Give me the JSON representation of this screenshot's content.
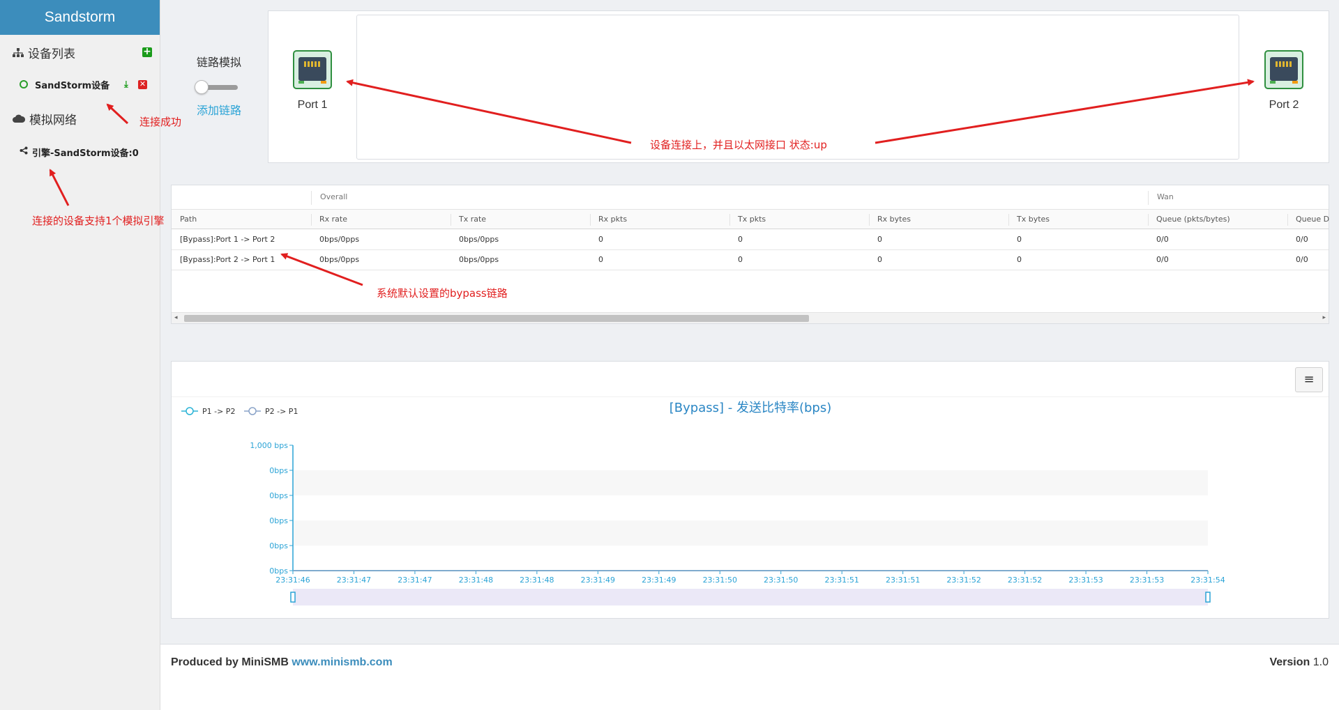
{
  "sidebar": {
    "brand": "Sandstorm",
    "devices_header": "设备列表",
    "device_name": "SandStorm设备",
    "network_header": "模拟网络",
    "engine_name": "引擎-SandStorm设备:0"
  },
  "link_sim": {
    "label": "链路模拟",
    "toggle_on": false,
    "add_link": "添加链路"
  },
  "topology": {
    "port1": "Port 1",
    "port2": "Port 2"
  },
  "annotations": {
    "connected": "连接成功",
    "engine_support": "连接的设备支持1个模拟引擎",
    "link_up": "设备连接上，并且以太网接口 状态:up",
    "bypass": "系统默认设置的bypass链路"
  },
  "stats": {
    "groups": [
      "Overall",
      "Wan"
    ],
    "headers": [
      "Path",
      "Rx rate",
      "Tx rate",
      "Rx pkts",
      "Tx pkts",
      "Rx bytes",
      "Tx bytes",
      "Queue (pkts/bytes)",
      "Queue D"
    ],
    "rows": [
      [
        "[Bypass]:Port 1 -> Port 2",
        "0bps/0pps",
        "0bps/0pps",
        "0",
        "0",
        "0",
        "0",
        "0/0",
        "0/0"
      ],
      [
        "[Bypass]:Port 2 -> Port 1",
        "0bps/0pps",
        "0bps/0pps",
        "0",
        "0",
        "0",
        "0",
        "0/0",
        "0/0"
      ]
    ]
  },
  "chart_data": {
    "type": "line",
    "title": "[Bypass] - 发送比特率(bps)",
    "menu_icon": "hamburger-menu-icon",
    "legend": [
      "P1 -> P2",
      "P2 -> P1"
    ],
    "y_tick_labels": [
      "1,000 bps",
      "0bps",
      "0bps",
      "0bps",
      "0bps",
      "0bps"
    ],
    "x_tick_labels": [
      "23:31:46",
      "23:31:47",
      "23:31:47",
      "23:31:48",
      "23:31:48",
      "23:31:49",
      "23:31:49",
      "23:31:50",
      "23:31:50",
      "23:31:51",
      "23:31:51",
      "23:31:52",
      "23:31:52",
      "23:31:53",
      "23:31:53",
      "23:31:54"
    ],
    "series": [
      {
        "name": "P1 -> P2",
        "values": [
          0,
          0,
          0,
          0,
          0,
          0,
          0,
          0,
          0,
          0,
          0,
          0,
          0,
          0,
          0,
          0
        ]
      },
      {
        "name": "P2 -> P1",
        "values": [
          0,
          0,
          0,
          0,
          0,
          0,
          0,
          0,
          0,
          0,
          0,
          0,
          0,
          0,
          0,
          0
        ]
      }
    ],
    "colors": {
      "axis": "#2aa3d6",
      "title": "#2a86c4",
      "series1": "#2ab3d6",
      "series2": "#8aa3c8"
    }
  },
  "footer": {
    "produced_by": "Produced by MiniSMB ",
    "url": "www.minismb.com",
    "version_label": "Version",
    "version": "1.0"
  }
}
